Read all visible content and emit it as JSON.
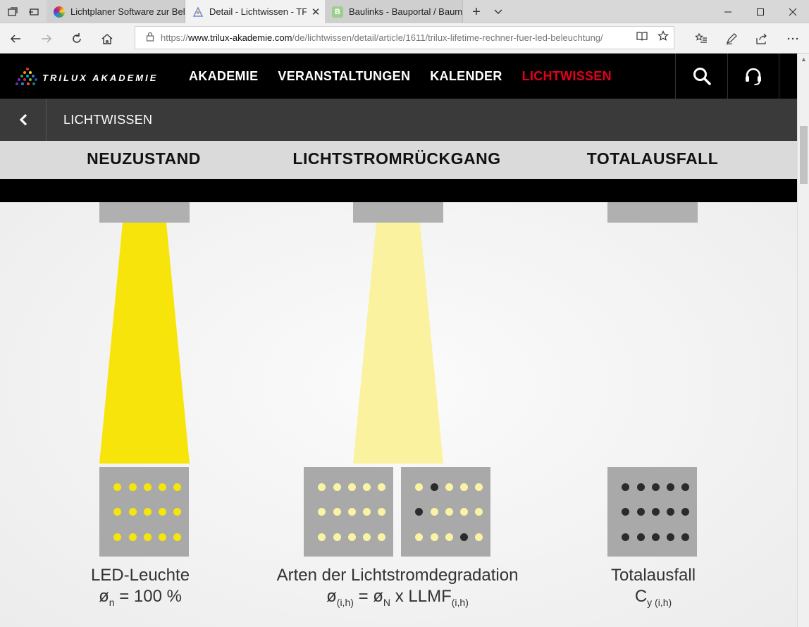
{
  "browser": {
    "tabs": [
      {
        "title": "Lichtplaner Software zur Bel",
        "active": false
      },
      {
        "title": "Detail - Lichtwissen - TF",
        "active": true
      },
      {
        "title": "Baulinks - Bauportal / Baum",
        "active": false
      }
    ],
    "tab_b_glyph": "B",
    "new_tab_glyph": "+",
    "url": {
      "prefix": "https://",
      "domain": "www.trilux-akademie.com",
      "path": "/de/lichtwissen/detail/article/1611/trilux-lifetime-rechner-fuer-led-beleuchtung/"
    }
  },
  "site": {
    "logo_text": "TRILUX AKADEMIE",
    "nav": [
      {
        "label": "AKADEMIE",
        "active": false
      },
      {
        "label": "VERANSTALTUNGEN",
        "active": false
      },
      {
        "label": "KALENDER",
        "active": false
      },
      {
        "label": "LICHTWISSEN",
        "active": true
      }
    ],
    "section_title": "LICHTWISSEN",
    "accent_color": "#e3001b"
  },
  "illustration": {
    "columns": [
      {
        "heading": "NEUZUSTAND",
        "caption_line1": "LED-Leuchte",
        "caption_line2_main": "ø",
        "caption_line2_sub": "n",
        "caption_line2_rest": " = 100 %"
      },
      {
        "heading": "LICHTSTROMRÜCKGANG",
        "caption_line1": "Arten der Lichtstromdegradation",
        "caption_line2_main": "ø",
        "caption_line2_sub": "(i,h)",
        "caption_line2_rest": " = ø",
        "caption_line2_sub2": "N",
        "caption_line2_rest2": " x LLMF",
        "caption_line2_sub3": "(i,h)"
      },
      {
        "heading": "TOTALAUSFALL",
        "caption_line1": "Totalausfall",
        "caption_line2_main": "C",
        "caption_line2_sub": "y (i,h)"
      }
    ],
    "panels": [
      {
        "name": "new-led-panel",
        "dots": [
          [
            1,
            1,
            1,
            1,
            1
          ],
          [
            1,
            1,
            1,
            1,
            1
          ],
          [
            1,
            1,
            1,
            1,
            1
          ]
        ],
        "on_color": "#f5e60a"
      },
      {
        "name": "dimmed-led-panel",
        "dots": [
          [
            1,
            1,
            1,
            1,
            1
          ],
          [
            1,
            1,
            1,
            1,
            1
          ],
          [
            1,
            1,
            1,
            1,
            1
          ]
        ],
        "on_color": "#fbf3a4"
      },
      {
        "name": "partial-failure-led-panel",
        "dots": [
          [
            1,
            0,
            1,
            1,
            1
          ],
          [
            0,
            1,
            1,
            1,
            1
          ],
          [
            1,
            1,
            1,
            0,
            1
          ]
        ],
        "on_color": "#fbf3a4"
      },
      {
        "name": "total-failure-led-panel",
        "dots": [
          [
            0,
            0,
            0,
            0,
            0
          ],
          [
            0,
            0,
            0,
            0,
            0
          ],
          [
            0,
            0,
            0,
            0,
            0
          ]
        ],
        "on_color": "#fbf3a4"
      }
    ],
    "off_color": "#2b2b2b",
    "beam_full_color": "#f7e40b",
    "beam_dim_color": "#fbf2a0"
  }
}
